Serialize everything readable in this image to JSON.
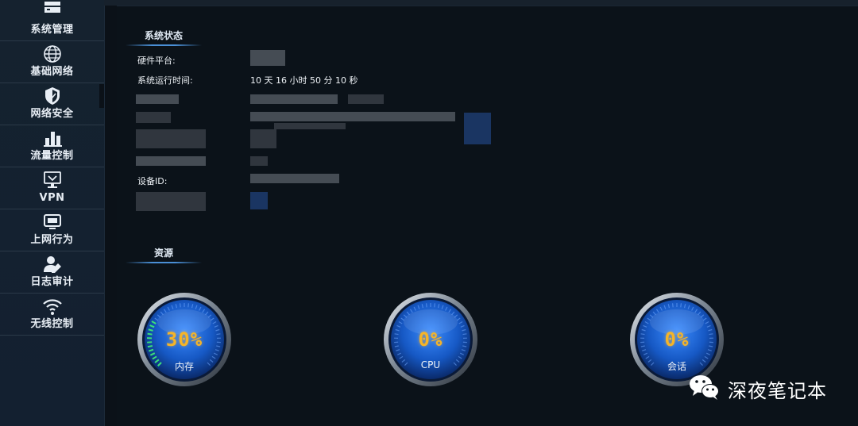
{
  "sidebar": {
    "items": [
      {
        "label": "系统管理",
        "icon": "server-icon"
      },
      {
        "label": "基础网络",
        "icon": "globe-icon"
      },
      {
        "label": "网络安全",
        "icon": "shield-icon"
      },
      {
        "label": "流量控制",
        "icon": "bar-chart-icon"
      },
      {
        "label": "VPN",
        "icon": "monitor-vpn-icon"
      },
      {
        "label": "上网行为",
        "icon": "monitor-icon"
      },
      {
        "label": "日志审计",
        "icon": "user-edit-icon"
      },
      {
        "label": "无线控制",
        "icon": "wifi-icon"
      }
    ]
  },
  "system_status": {
    "title": "系统状态",
    "hardware_label": "硬件平台:",
    "uptime_label": "系统运行时间:",
    "uptime_value": "10 天 16 小时 50 分 10 秒",
    "device_id_label": "设备ID:"
  },
  "resources": {
    "title": "资源",
    "gauges": [
      {
        "value": "30%",
        "name": "内存",
        "fraction": 0.3
      },
      {
        "value": "0%",
        "name": "CPU",
        "fraction": 0
      },
      {
        "value": "0%",
        "name": "会话",
        "fraction": 0
      }
    ]
  },
  "watermark": {
    "text": "深夜笔记本",
    "icon": "wechat-icon"
  },
  "colors": {
    "accent": "#4a8fd6",
    "gauge_text": "#f5b428",
    "gauge_face": "#1a5fc8",
    "background": "#0b1219"
  }
}
